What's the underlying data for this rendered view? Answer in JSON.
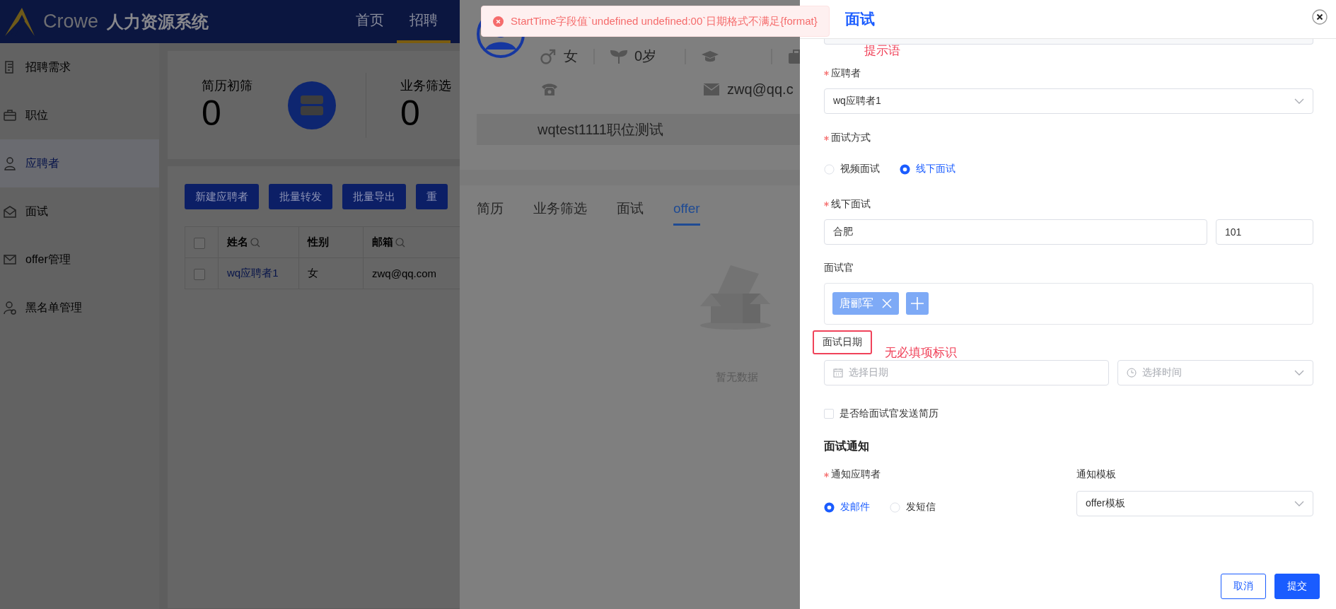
{
  "header": {
    "logo_text": "Crowe",
    "system_name": "人力资源系统",
    "nav": [
      {
        "label": "首页",
        "selected": false
      },
      {
        "label": "招聘",
        "selected": true
      }
    ]
  },
  "sidebar": {
    "items": [
      {
        "label": "招聘需求",
        "selected": false
      },
      {
        "label": "职位",
        "selected": false
      },
      {
        "label": "应聘者",
        "selected": true
      },
      {
        "label": "面试",
        "selected": false
      },
      {
        "label": "offer管理",
        "selected": false
      },
      {
        "label": "黑名单管理",
        "selected": false
      }
    ]
  },
  "stats": [
    {
      "label": "简历初筛",
      "value": "0"
    },
    {
      "label": "业务筛选",
      "value": "0"
    }
  ],
  "toolbar": {
    "buttons": [
      "新建应聘者",
      "批量转发",
      "批量导出",
      "重"
    ]
  },
  "table": {
    "header_checked": false,
    "columns": [
      {
        "label": "姓名",
        "searchable": true
      },
      {
        "label": "性别",
        "searchable": false
      },
      {
        "label": "邮箱",
        "searchable": true
      }
    ],
    "rows": [
      {
        "checked": false,
        "cells": [
          "wq应聘者1",
          "女",
          "zwq@qq.com"
        ]
      }
    ]
  },
  "candidate": {
    "gender": "女",
    "age": "0岁",
    "email": "zwq@qq.c",
    "position": "wqtest1111职位测试",
    "tabs": [
      {
        "label": "简历",
        "selected": false
      },
      {
        "label": "业务筛选",
        "selected": false
      },
      {
        "label": "面试",
        "selected": false
      },
      {
        "label": "offer",
        "selected": true
      }
    ],
    "empty_text": "暂无数据"
  },
  "toast": {
    "message": "StartTime字段值`undefined undefined:00`日期格式不满足{format}"
  },
  "drawer": {
    "title": "面试",
    "applicant": {
      "label": "应聘者",
      "required": true,
      "value": "wq应聘者1"
    },
    "method": {
      "label": "面试方式",
      "required": true,
      "options": [
        {
          "label": "视频面试",
          "selected": false
        },
        {
          "label": "线下面试",
          "selected": true
        }
      ]
    },
    "location": {
      "label": "线下面试",
      "required": true,
      "place": "合肥",
      "room": "101"
    },
    "interviewers": {
      "label": "面试官",
      "tags": [
        "唐郦军"
      ]
    },
    "date": {
      "label": "面试日期",
      "required": false,
      "highlighted": true,
      "date_placeholder": "选择日期",
      "time_placeholder": "选择时间"
    },
    "send_resume": {
      "label": "是否给面试官发送简历",
      "checked": false
    },
    "notice": {
      "title": "面试通知",
      "notify": {
        "label": "通知应聘者",
        "required": true,
        "options": [
          {
            "label": "发邮件",
            "selected": true
          },
          {
            "label": "发短信",
            "selected": false
          }
        ]
      },
      "template": {
        "label": "通知模板",
        "value": "offer模板"
      }
    },
    "buttons": [
      {
        "label": "取消",
        "kind": "secondary"
      },
      {
        "label": "提交",
        "kind": "primary"
      }
    ]
  },
  "annotations": [
    {
      "text": "提示语"
    },
    {
      "text": "无必填项标识"
    }
  ]
}
